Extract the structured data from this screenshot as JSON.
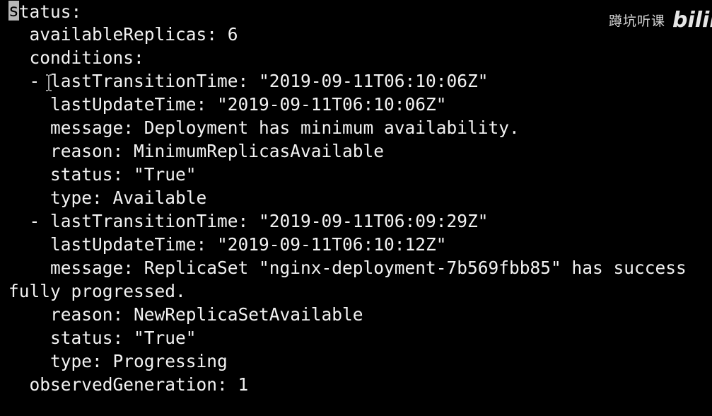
{
  "terminal": {
    "lines": [
      {
        "cursor_text": "s",
        "text": "tatus:"
      },
      {
        "text": "  availableReplicas: 6"
      },
      {
        "text": "  conditions:"
      },
      {
        "text": "  - lastTransitionTime: \"2019-09-11T06:10:06Z\""
      },
      {
        "text": "    lastUpdateTime: \"2019-09-11T06:10:06Z\""
      },
      {
        "text": "    message: Deployment has minimum availability."
      },
      {
        "text": "    reason: MinimumReplicasAvailable"
      },
      {
        "text": "    status: \"True\""
      },
      {
        "text": "    type: Available"
      },
      {
        "text": "  - lastTransitionTime: \"2019-09-11T06:09:29Z\""
      },
      {
        "text": "    lastUpdateTime: \"2019-09-11T06:10:12Z\""
      },
      {
        "text": "    message: ReplicaSet \"nginx-deployment-7b569fbb85\" has success"
      },
      {
        "text": "fully progressed."
      },
      {
        "text": "    reason: NewReplicaSetAvailable"
      },
      {
        "text": "    status: \"True\""
      },
      {
        "text": "    type: Progressing"
      },
      {
        "text": "  observedGeneration: 1"
      }
    ]
  },
  "watermark": {
    "channel": "蹲坑听课",
    "logo": "bilibili"
  },
  "colors": {
    "background": "#000000",
    "text": "#f2f2f2",
    "cursor": "#b8b8b8"
  }
}
